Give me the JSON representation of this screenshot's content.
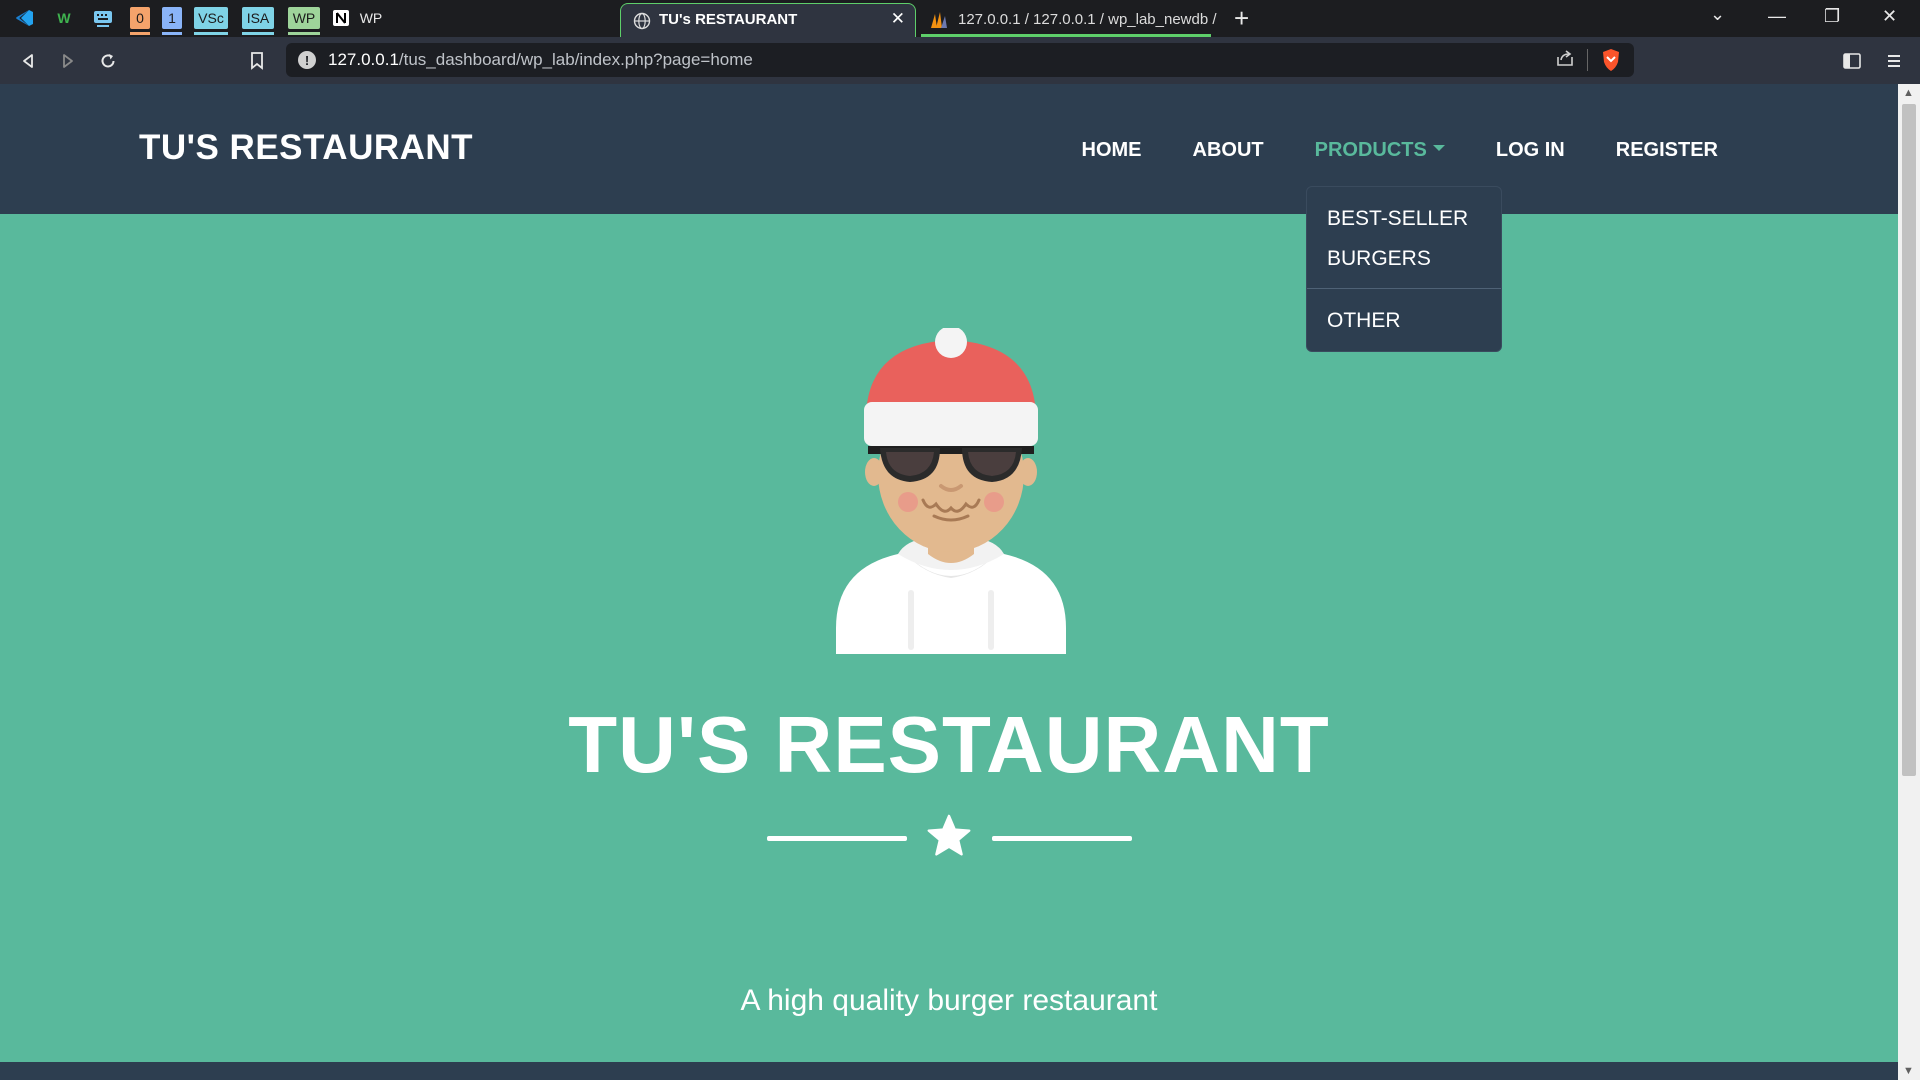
{
  "browser": {
    "bookmarks": [
      {
        "name": "vscode-icon",
        "label": ""
      },
      {
        "name": "w-icon",
        "label": "W"
      },
      {
        "name": "keyboard-icon",
        "label": ""
      },
      {
        "name": "bookmark-0",
        "label": "0"
      },
      {
        "name": "bookmark-1",
        "label": "1"
      },
      {
        "name": "bookmark-vsc",
        "label": "VSc"
      },
      {
        "name": "bookmark-isa",
        "label": "ISA"
      },
      {
        "name": "bookmark-wp",
        "label": "WP"
      },
      {
        "name": "notion-icon",
        "label": "N"
      },
      {
        "name": "bookmark-wp-text",
        "label": "WP"
      }
    ],
    "tabs": [
      {
        "title": "TU's RESTAURANT",
        "active": true
      },
      {
        "title": "127.0.0.1 / 127.0.0.1 / wp_lab_newdb /",
        "active": false
      }
    ],
    "new_tab": "+",
    "window_controls": {
      "chevron": "⌄",
      "minimize": "—",
      "restore": "❐",
      "close": "✕"
    },
    "url": {
      "host": "127.0.0.1",
      "path": "/tus_dashboard/wp_lab/index.php?page=home"
    }
  },
  "site": {
    "brand": "TU'S RESTAURANT",
    "nav": [
      {
        "label": "HOME",
        "active": false
      },
      {
        "label": "ABOUT",
        "active": false
      },
      {
        "label": "PRODUCTS",
        "active": true
      },
      {
        "label": "LOG IN",
        "active": false
      },
      {
        "label": "REGISTER",
        "active": false
      }
    ],
    "dropdown": [
      "BEST-SELLER",
      "BURGERS",
      "OTHER"
    ],
    "hero": {
      "title": "TU'S RESTAURANT",
      "subtitle": "A high quality burger restaurant"
    }
  },
  "colors": {
    "nav_bg": "#2d3e50",
    "hero_bg": "#59b99c",
    "accent": "#59b99c",
    "tab_underline": "#5ecf6a"
  }
}
